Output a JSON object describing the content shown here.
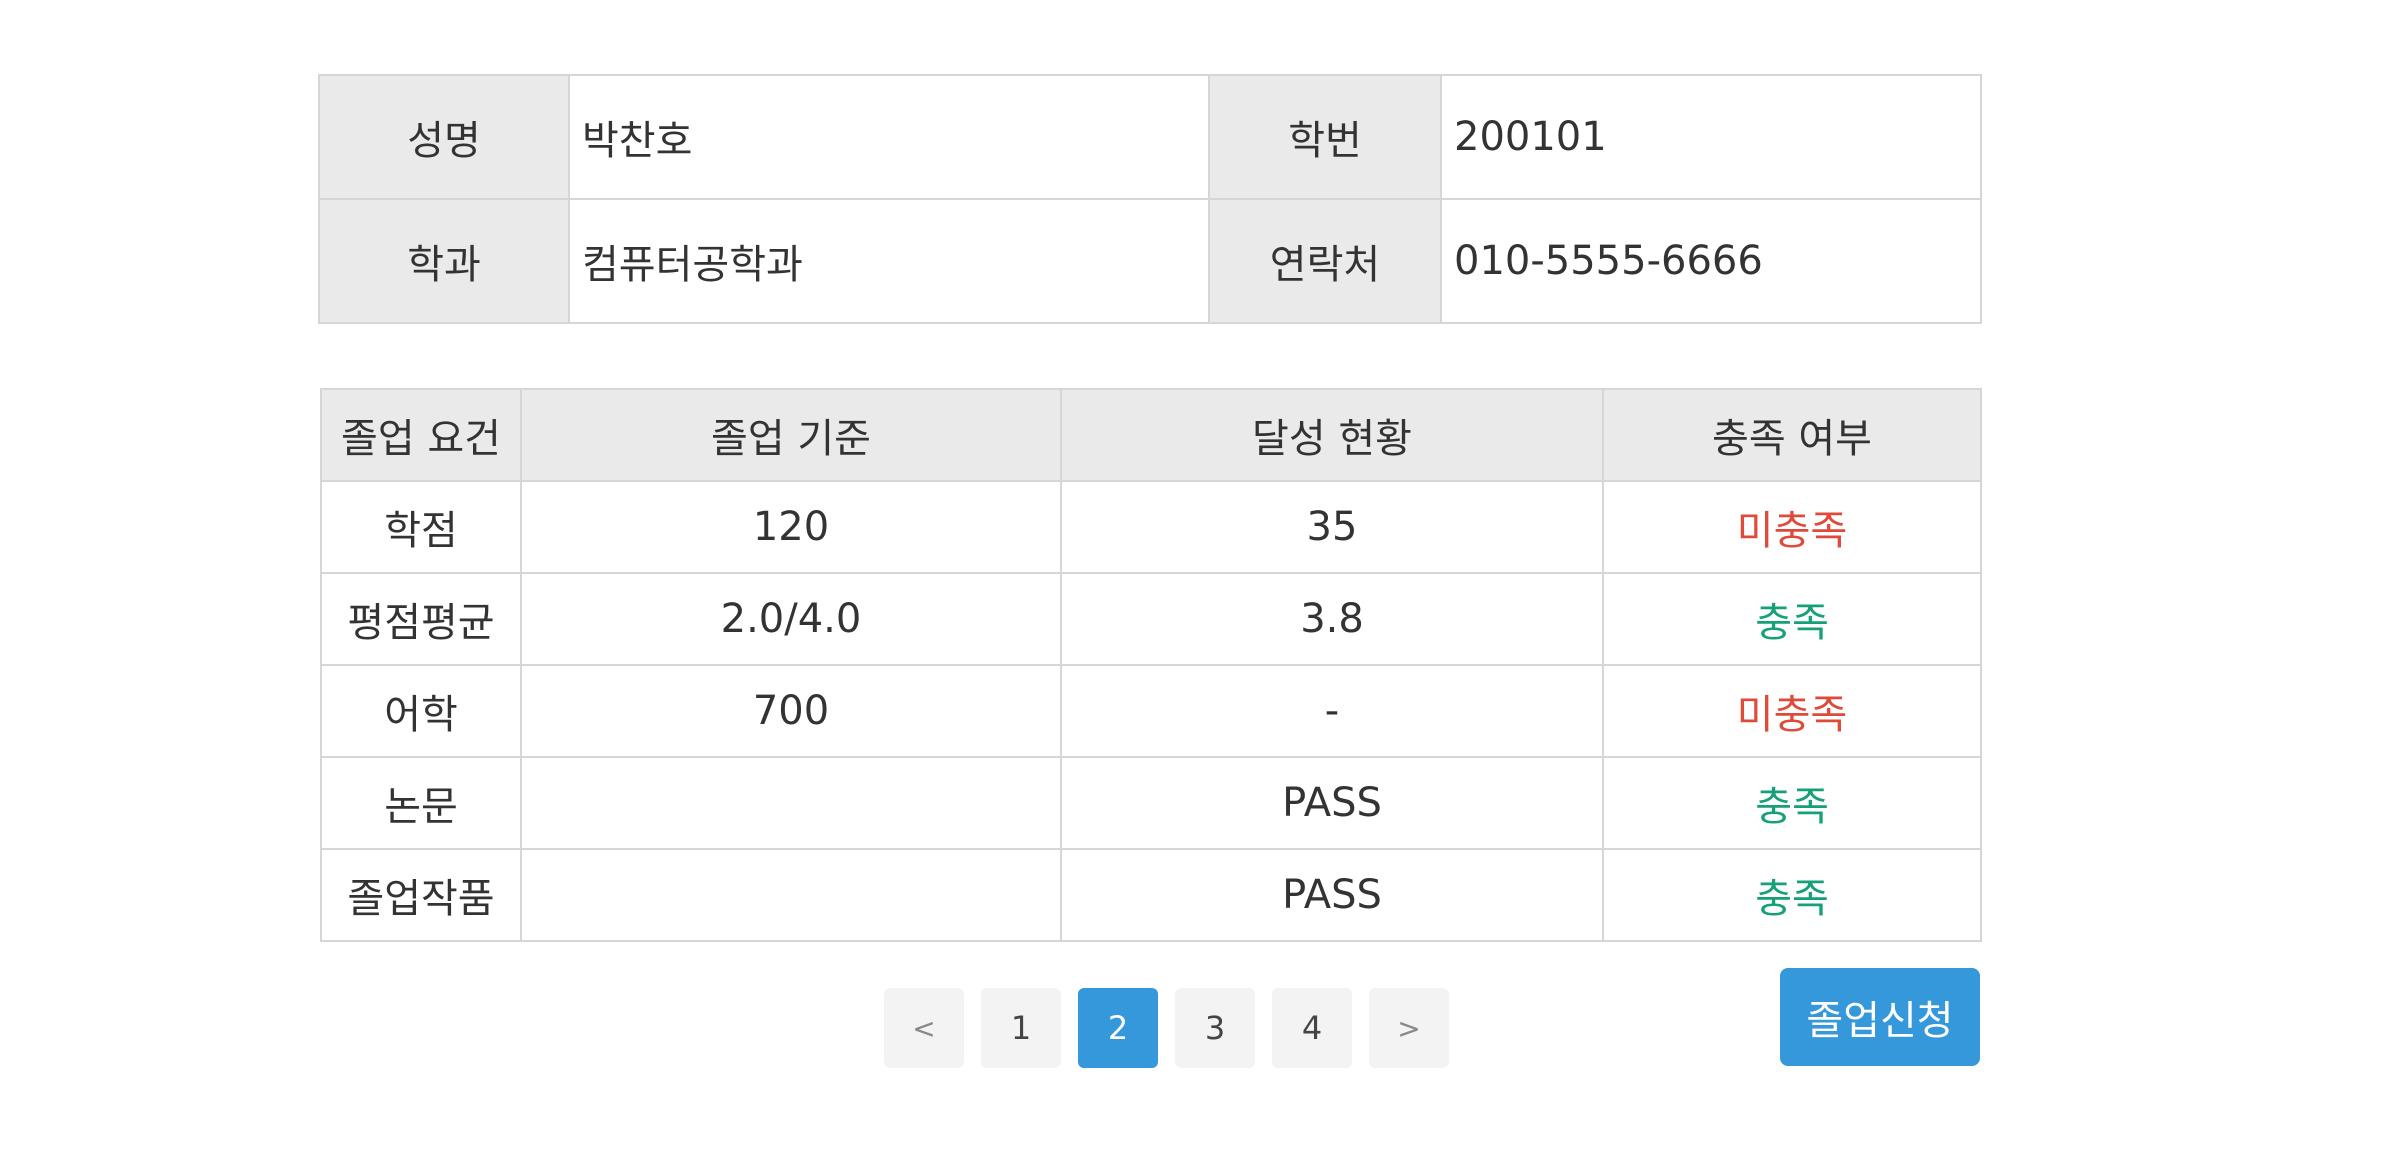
{
  "student": {
    "name_label": "성명",
    "name_value": "박찬호",
    "id_label": "학번",
    "id_value": "200101",
    "dept_label": "학과",
    "dept_value": "컴퓨터공학과",
    "contact_label": "연락처",
    "contact_value": "010-5555-6666"
  },
  "requirements": {
    "headers": [
      "졸업 요건",
      "졸업 기준",
      "달성 현황",
      "충족 여부"
    ],
    "rows": [
      {
        "requirement": "학점",
        "criterion": "120",
        "achieved": "35",
        "status": "미충족",
        "status_type": "fail"
      },
      {
        "requirement": "평점평균",
        "criterion": "2.0/4.0",
        "achieved": "3.8",
        "status": "충족",
        "status_type": "pass"
      },
      {
        "requirement": "어학",
        "criterion": "700",
        "achieved": "-",
        "status": "미충족",
        "status_type": "fail"
      },
      {
        "requirement": "논문",
        "criterion": "",
        "achieved": "PASS",
        "status": "충족",
        "status_type": "pass"
      },
      {
        "requirement": "졸업작품",
        "criterion": "",
        "achieved": "PASS",
        "status": "충족",
        "status_type": "pass"
      }
    ]
  },
  "pagination": {
    "prev": "<",
    "pages": [
      "1",
      "2",
      "3",
      "4"
    ],
    "current": "2",
    "next": ">"
  },
  "actions": {
    "apply_label": "졸업신청"
  },
  "colors": {
    "accent": "#3498db",
    "fail": "#e04a3a",
    "pass": "#15a07a",
    "header_bg": "#eaeaea"
  }
}
